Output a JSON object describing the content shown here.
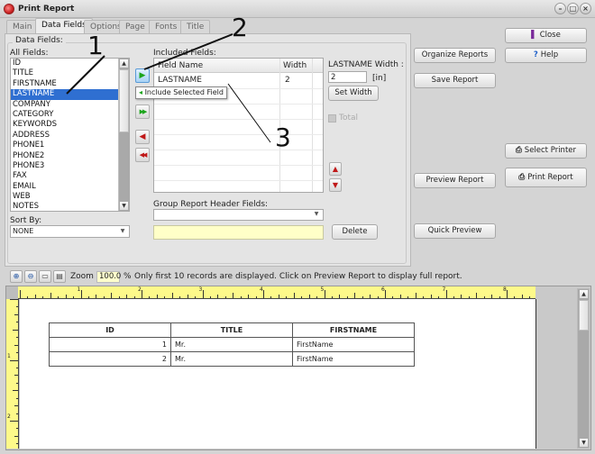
{
  "window": {
    "title": "Print Report",
    "controls": [
      "minimize",
      "maximize",
      "close"
    ]
  },
  "tabs": [
    {
      "label": "Main",
      "active": false
    },
    {
      "label": "Data Fields",
      "active": true
    },
    {
      "label": "Options",
      "active": false
    },
    {
      "label": "Page",
      "active": false
    },
    {
      "label": "Fonts",
      "active": false
    },
    {
      "label": "Title",
      "active": false
    }
  ],
  "data_fields": {
    "group_label": "Data Fields:",
    "all_fields_label": "All Fields:",
    "all_fields": [
      "ID",
      "TITLE",
      "FIRSTNAME",
      "LASTNAME",
      "COMPANY",
      "CATEGORY",
      "KEYWORDS",
      "ADDRESS",
      "PHONE1",
      "PHONE2",
      "PHONE3",
      "FAX",
      "EMAIL",
      "WEB",
      "NOTES"
    ],
    "selected_field": "LASTNAME",
    "sort_by_label": "Sort By:",
    "sort_by_value": "NONE",
    "included_fields_label": "Included Fields:",
    "grid_headers": {
      "field_name": "Field Name",
      "width": "Width"
    },
    "included_fields": [
      {
        "field_name": "LASTNAME",
        "width": "2"
      }
    ],
    "tooltip": "Include Selected Field",
    "width_label": "LASTNAME Width :",
    "width_value": "2",
    "width_unit": "[in]",
    "set_width_label": "Set Width",
    "total_label": "Total",
    "total_checked": false,
    "group_header_label": "Group Report Header Fields:",
    "group_header_value": "",
    "group_header_text": "",
    "delete_label": "Delete"
  },
  "arrow_buttons": {
    "include": "▶",
    "include_all": "▶▶",
    "remove": "◀",
    "remove_all": "◀◀",
    "move_up": "▲",
    "move_down": "▼"
  },
  "side_buttons": {
    "close": "Close",
    "help": "Help",
    "organize_reports": "Organize Reports",
    "save_report": "Save Report",
    "select_printer": "Select Printer",
    "print_report": "Print Report",
    "preview_report": "Preview Report",
    "quick_preview": "Quick Preview"
  },
  "annotations": [
    "1",
    "2",
    "3"
  ],
  "preview": {
    "zoom_label": "Zoom",
    "zoom_value": "100.0",
    "zoom_unit": "%",
    "notice": "Only first 10 records are displayed. Click on Preview Report to display full report.",
    "ruler_h_labels": [
      "1",
      "2",
      "3",
      "4",
      "5",
      "6",
      "7",
      "8"
    ],
    "ruler_v_labels": [
      "1",
      "2"
    ],
    "table": {
      "headers": [
        "ID",
        "TITLE",
        "FIRSTNAME"
      ],
      "rows": [
        [
          "1",
          "Mr.",
          "FirstName"
        ],
        [
          "2",
          "Mr.",
          "FirstName"
        ]
      ]
    }
  },
  "colors": {
    "selection": "#2f6fd1",
    "ruler": "#fdf98a",
    "highlight_input": "#ffffcc"
  }
}
